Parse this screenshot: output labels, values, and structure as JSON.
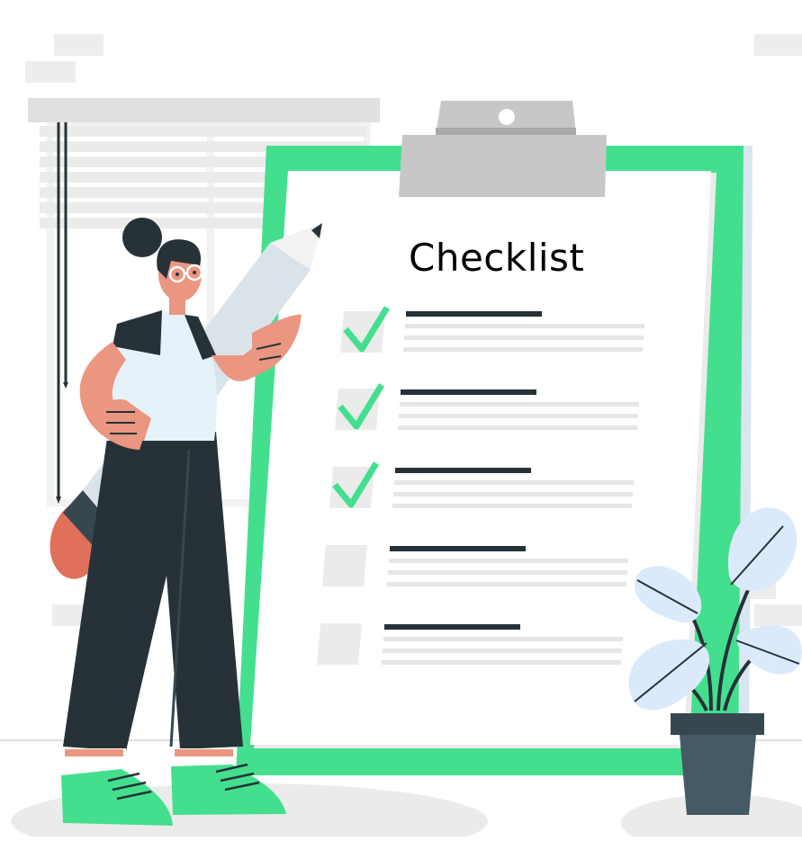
{
  "clipboard": {
    "title": "Checklist",
    "items": [
      {
        "checked": true
      },
      {
        "checked": true
      },
      {
        "checked": true
      },
      {
        "checked": false
      },
      {
        "checked": false
      }
    ]
  },
  "colors": {
    "accent": "#44df8e",
    "dark": "#263238",
    "skin": "#eb9681",
    "light_gray": "#e6e6e6",
    "pale_blue": "#dbeafa",
    "clip_gray": "#c7c7c7"
  },
  "icons": [
    "check-icon",
    "pencil-icon",
    "plant-icon"
  ]
}
